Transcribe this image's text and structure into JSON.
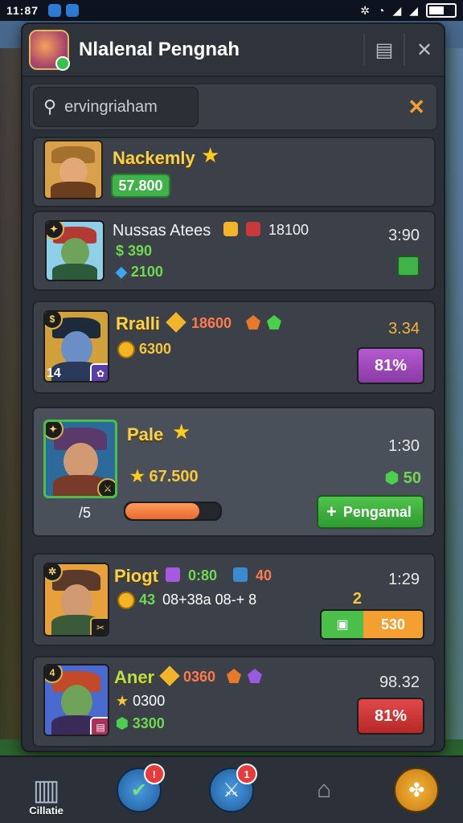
{
  "status_bar": {
    "time": "11:87"
  },
  "header": {
    "title": "Nlalenal Pengnah"
  },
  "search": {
    "value": "ervingriaham",
    "placeholder": "ervingriaham"
  },
  "cards": [
    {
      "name": "Nackemly",
      "amount": "57.800"
    },
    {
      "name": "Nussas Atees",
      "price": "18100",
      "stat1": "390",
      "stat2": "2100",
      "time": "3:90"
    },
    {
      "name": "Rralli",
      "price": "18600",
      "coins": "6300",
      "level": "14",
      "time": "3.34",
      "percent": "81%"
    },
    {
      "name": "Pale",
      "value": "67.500",
      "level": "/5",
      "time": "1:30",
      "gems": "50",
      "action": "Pengamal",
      "progress": 0.78
    },
    {
      "name": "Piogt",
      "price": "0:80",
      "extra": "40",
      "coins": "43",
      "desc": "08+38a 08-+ 8",
      "time": "1:29",
      "badge": "2",
      "button_value": "530"
    },
    {
      "name": "Aner",
      "price": "0360",
      "time": "98.32",
      "coins": "0300",
      "gems": "3300",
      "percent": "81%"
    }
  ],
  "bottom_nav": [
    {
      "label": "Cillatie",
      "icon": "castle-icon"
    },
    {
      "label": "",
      "icon": "checkmark-icon",
      "notifications": ""
    },
    {
      "label": "",
      "icon": "sword-icon",
      "notifications": "1"
    },
    {
      "label": "",
      "icon": "tower-icon"
    },
    {
      "label": "",
      "icon": "orb-icon"
    }
  ]
}
